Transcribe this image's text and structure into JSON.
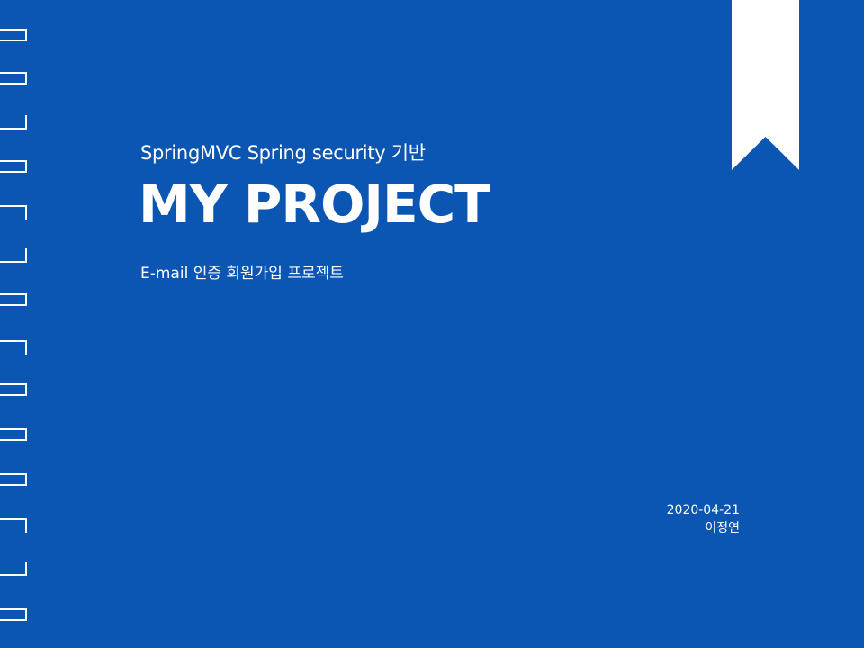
{
  "slide": {
    "subtitle": "SpringMVC Spring security 기반",
    "title": "MY PROJECT",
    "description": "E-mail 인증 회원가입 프로젝트",
    "date": "2020-04-21",
    "author": "이정연"
  },
  "decor": {
    "binding_icon": "notebook-binding-rings",
    "bookmark_icon": "bookmark-ribbon",
    "colors": {
      "background": "#0b55b3",
      "foreground": "#ffffff"
    }
  }
}
